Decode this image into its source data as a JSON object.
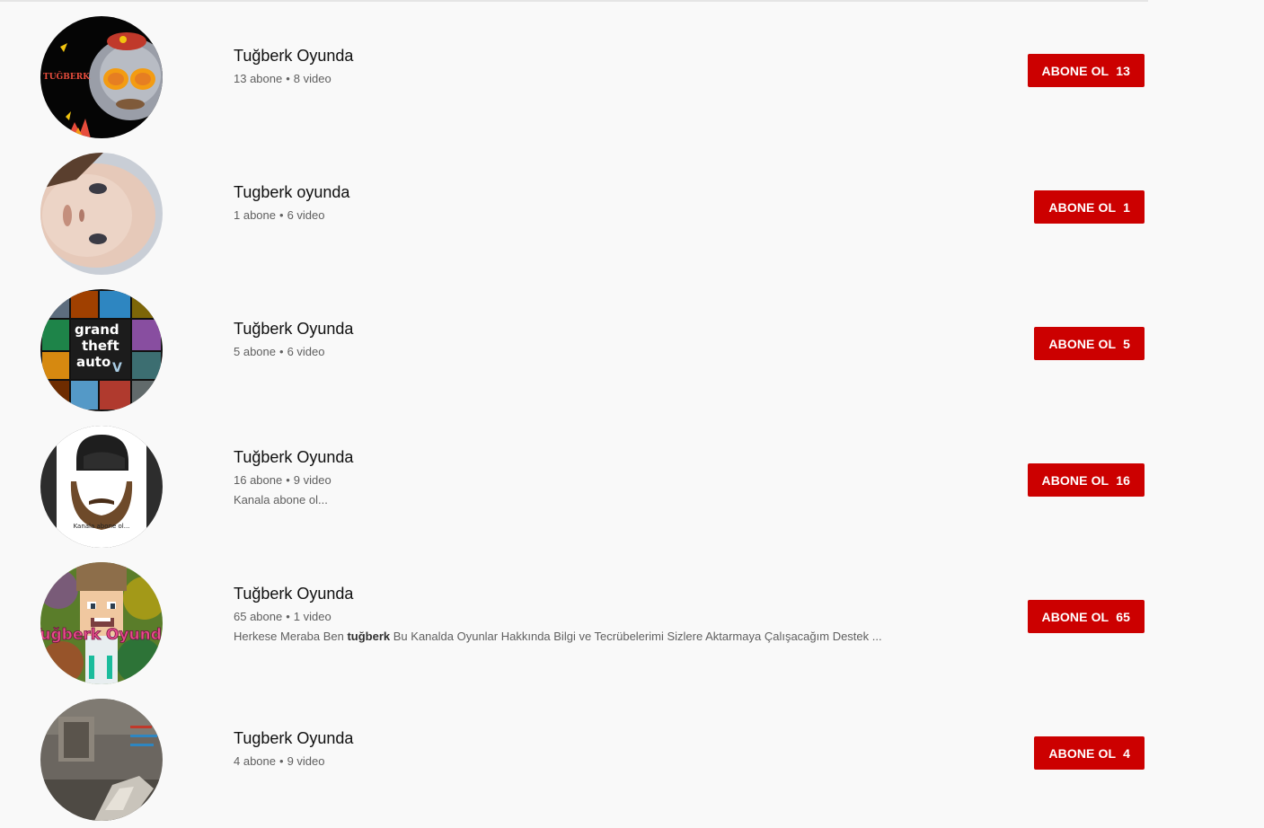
{
  "channels": [
    {
      "name": "Tuğberk Oyunda",
      "subscribers": "13 abone",
      "videos": "8 video",
      "subscribe_label": "ABONE OL",
      "subscribe_count": "13",
      "avatar_text": "TUĞBERK"
    },
    {
      "name": "Tugberk oyunda",
      "subscribers": "1 abone",
      "videos": "6 video",
      "subscribe_label": "ABONE OL",
      "subscribe_count": "1"
    },
    {
      "name": "Tuğberk Oyunda",
      "subscribers": "5 abone",
      "videos": "6 video",
      "subscribe_label": "ABONE OL",
      "subscribe_count": "5",
      "avatar_text": [
        "grand",
        "theft",
        "auto"
      ]
    },
    {
      "name": "Tuğberk Oyunda",
      "subscribers": "16 abone",
      "videos": "9 video",
      "description": "Kanala abone ol...",
      "subscribe_label": "ABONE OL",
      "subscribe_count": "16",
      "avatar_text": "Kanala abone ol..."
    },
    {
      "name": "Tuğberk Oyunda",
      "subscribers": "65 abone",
      "videos": "1 video",
      "description_pre": "Herkese Meraba Ben",
      "description_bold": "tuğberk",
      "description_post": "Bu Kanalda Oyunlar Hakkında Bilgi ve Tecrübelerimi Sizlere Aktarmaya Çalışacağım Destek ...",
      "subscribe_label": "ABONE OL",
      "subscribe_count": "65",
      "avatar_text": "Tuğberk Oyunda"
    },
    {
      "name": "Tugberk Oyunda",
      "subscribers": "4 abone",
      "videos": "9 video",
      "subscribe_label": "ABONE OL",
      "subscribe_count": "4"
    }
  ],
  "meta_separator": "•",
  "colors": {
    "subscribe_bg": "#cc0000",
    "page_bg": "#f9f9f9",
    "meta_text": "#606060"
  }
}
